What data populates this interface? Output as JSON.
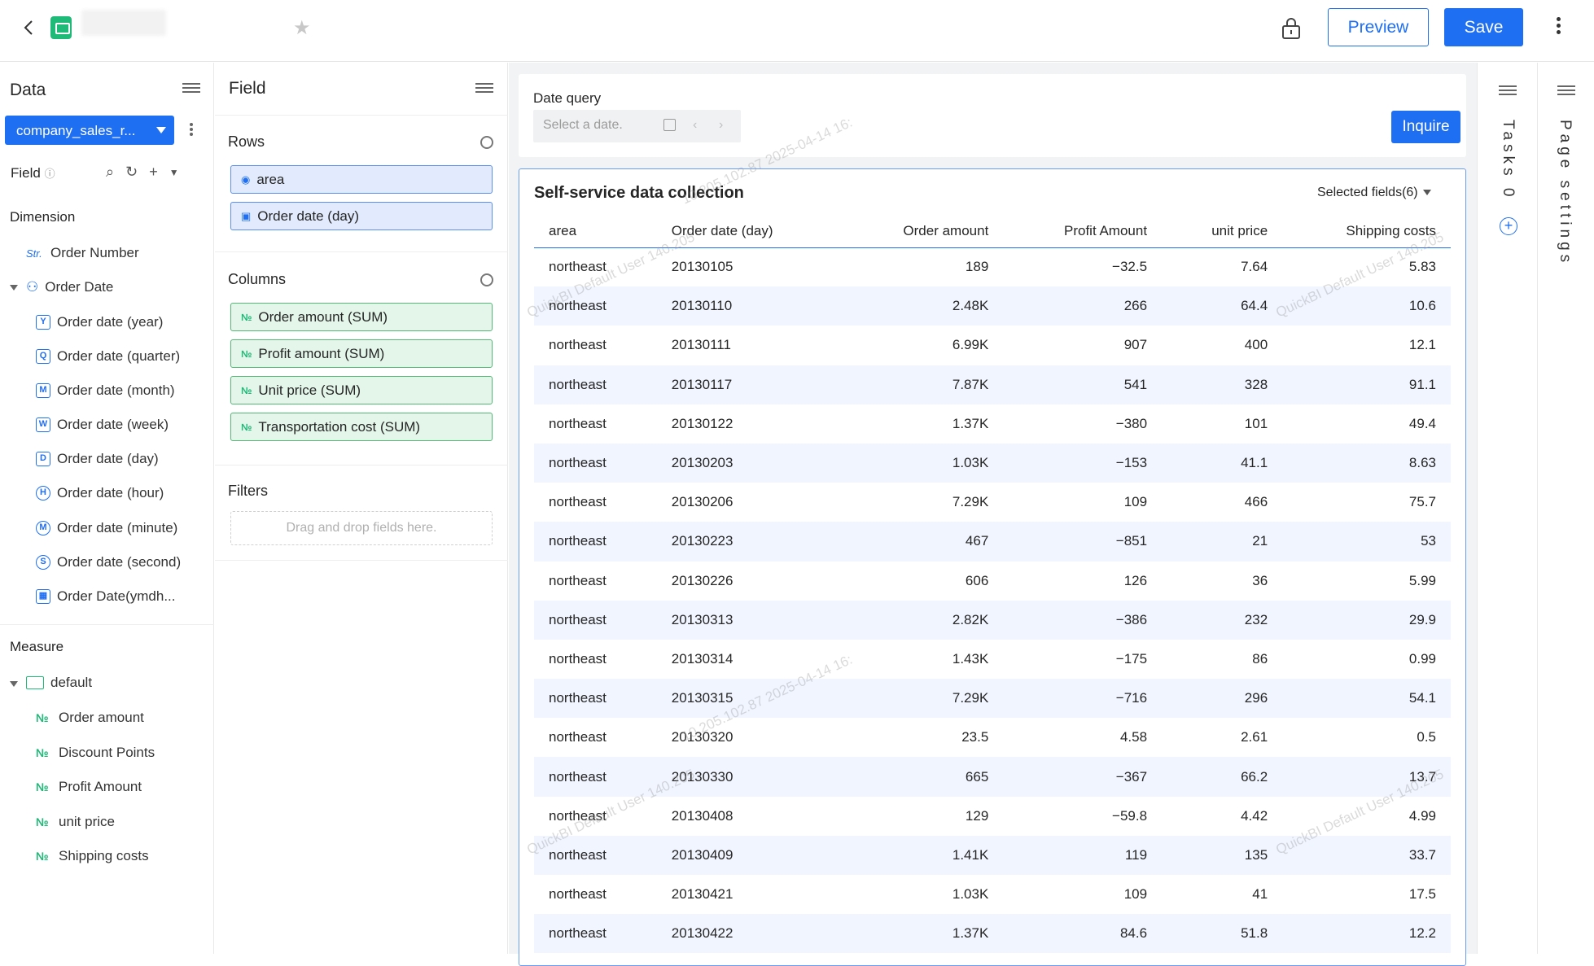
{
  "header": {
    "preview_label": "Preview",
    "save_label": "Save"
  },
  "data_panel": {
    "title": "Data",
    "dataset_name": "company_sales_r...",
    "field_label": "Field",
    "dimension_label": "Dimension",
    "measure_label": "Measure",
    "dimensions": [
      {
        "label": "Order Number",
        "icon": "Str"
      },
      {
        "label": "Order Date",
        "icon": "hierarchy-icon"
      },
      {
        "label": "Order date (year)",
        "icon": "Y"
      },
      {
        "label": "Order date (quarter)",
        "icon": "Q"
      },
      {
        "label": "Order date (month)",
        "icon": "M"
      },
      {
        "label": "Order date (week)",
        "icon": "W"
      },
      {
        "label": "Order date (day)",
        "icon": "D"
      },
      {
        "label": "Order date (hour)",
        "icon": "H"
      },
      {
        "label": "Order date (minute)",
        "icon": "M"
      },
      {
        "label": "Order date (second)",
        "icon": "S"
      },
      {
        "label": "Order Date(ymdh...",
        "icon": "calendar-icon"
      }
    ],
    "measure_folder": "default",
    "measures": [
      "Order amount",
      "Discount Points",
      "Profit Amount",
      "unit price",
      "Shipping costs"
    ]
  },
  "field_panel": {
    "title": "Field",
    "rows_label": "Rows",
    "rows": [
      "area",
      "Order date (day)"
    ],
    "columns_label": "Columns",
    "columns": [
      "Order amount (SUM)",
      "Profit amount (SUM)",
      "Unit price (SUM)",
      "Transportation cost (SUM)"
    ],
    "filters_label": "Filters",
    "filters_placeholder": "Drag and drop fields here."
  },
  "query": {
    "label": "Date query",
    "placeholder": "Select a date.",
    "inquire_label": "Inquire"
  },
  "table": {
    "title": "Self-service data collection",
    "selected_fields": "Selected fields(6)",
    "headers": [
      "area",
      "Order date (day)",
      "Order amount",
      "Profit Amount",
      "unit price",
      "Shipping costs"
    ],
    "rows": [
      [
        "northeast",
        "20130105",
        "189",
        "−32.5",
        "7.64",
        "5.83"
      ],
      [
        "northeast",
        "20130110",
        "2.48K",
        "266",
        "64.4",
        "10.6"
      ],
      [
        "northeast",
        "20130111",
        "6.99K",
        "907",
        "400",
        "12.1"
      ],
      [
        "northeast",
        "20130117",
        "7.87K",
        "541",
        "328",
        "91.1"
      ],
      [
        "northeast",
        "20130122",
        "1.37K",
        "−380",
        "101",
        "49.4"
      ],
      [
        "northeast",
        "20130203",
        "1.03K",
        "−153",
        "41.1",
        "8.63"
      ],
      [
        "northeast",
        "20130206",
        "7.29K",
        "109",
        "466",
        "75.7"
      ],
      [
        "northeast",
        "20130223",
        "467",
        "−851",
        "21",
        "53"
      ],
      [
        "northeast",
        "20130226",
        "606",
        "126",
        "36",
        "5.99"
      ],
      [
        "northeast",
        "20130313",
        "2.82K",
        "−386",
        "232",
        "29.9"
      ],
      [
        "northeast",
        "20130314",
        "1.43K",
        "−175",
        "86",
        "0.99"
      ],
      [
        "northeast",
        "20130315",
        "7.29K",
        "−716",
        "296",
        "54.1"
      ],
      [
        "northeast",
        "20130320",
        "23.5",
        "4.58",
        "2.61",
        "0.5"
      ],
      [
        "northeast",
        "20130330",
        "665",
        "−367",
        "66.2",
        "13.7"
      ],
      [
        "northeast",
        "20130408",
        "129",
        "−59.8",
        "4.42",
        "4.99"
      ],
      [
        "northeast",
        "20130409",
        "1.41K",
        "119",
        "135",
        "33.7"
      ],
      [
        "northeast",
        "20130421",
        "1.03K",
        "109",
        "41",
        "17.5"
      ],
      [
        "northeast",
        "20130422",
        "1.37K",
        "84.6",
        "51.8",
        "12.2"
      ]
    ]
  },
  "watermarks": {
    "a": "10.205.102.87 2025-04-14 16:",
    "b": "QuickBI Default User 140.205"
  },
  "rails": {
    "tasks_label": "Tasks",
    "tasks_count": "0",
    "page_settings_label": "Page settings"
  }
}
